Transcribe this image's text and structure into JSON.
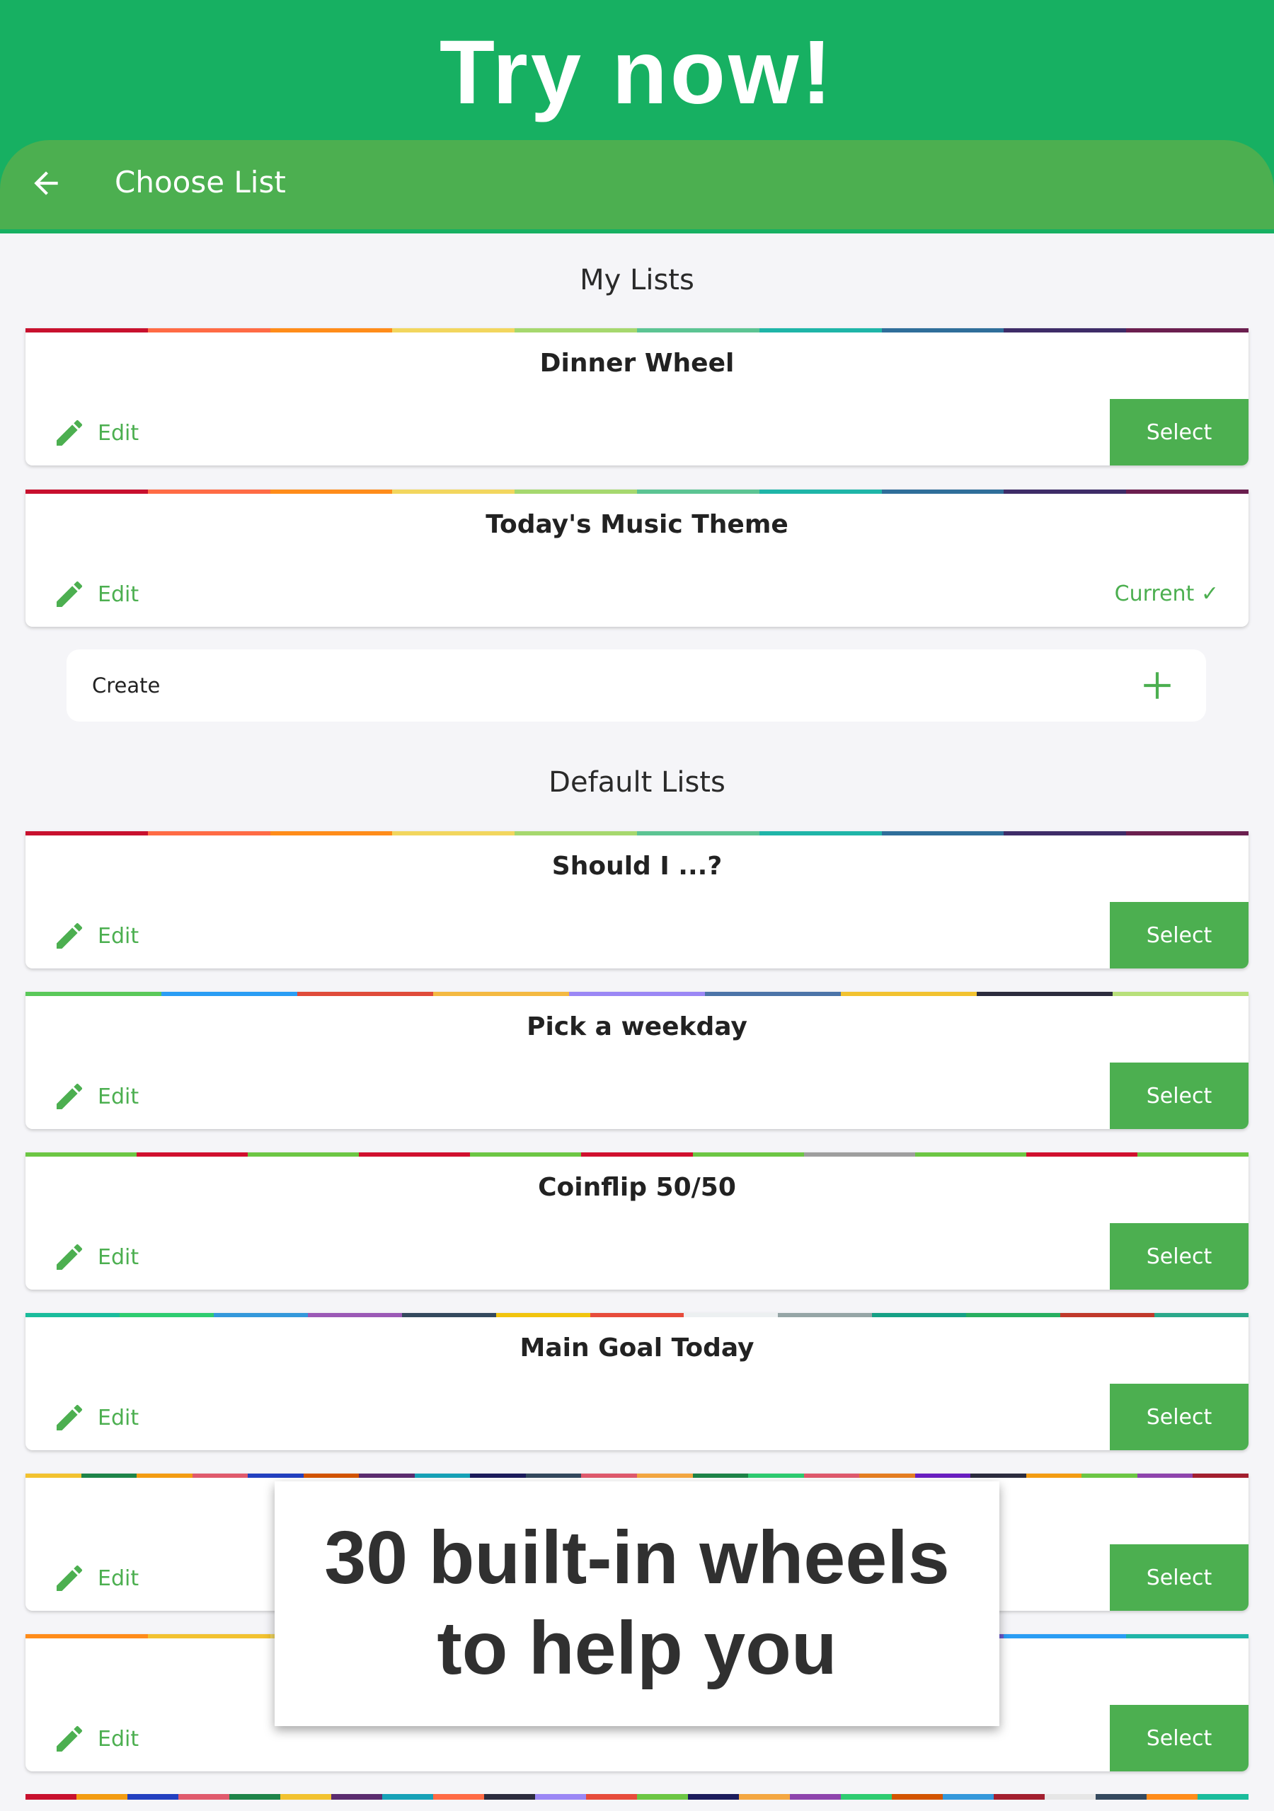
{
  "banner": {
    "title": "Try now!"
  },
  "appbar": {
    "title": "Choose List"
  },
  "my_lists": {
    "heading": "My Lists",
    "items": [
      {
        "title": "Dinner Wheel",
        "edit_label": "Edit",
        "action_label": "Select",
        "state": "select",
        "stripe": [
          "#c8102e",
          "#ff6b45",
          "#ff8c1a",
          "#f2d65e",
          "#a6d86e",
          "#5cc493",
          "#1fb5a8",
          "#2f6e9a",
          "#3e2c68",
          "#6b1f4f"
        ]
      },
      {
        "title": "Today's Music Theme",
        "edit_label": "Edit",
        "action_label": "Current ✓",
        "state": "current",
        "stripe": [
          "#c8102e",
          "#ff6b45",
          "#ff8c1a",
          "#f2d65e",
          "#a6d86e",
          "#5cc493",
          "#1fb5a8",
          "#2f6e9a",
          "#3e2c68",
          "#6b1f4f"
        ]
      }
    ],
    "create_label": "Create"
  },
  "default_lists": {
    "heading": "Default Lists",
    "items": [
      {
        "title": "Should I ...?",
        "edit_label": "Edit",
        "action_label": "Select",
        "stripe": [
          "#c8102e",
          "#ff6b45",
          "#ff8c1a",
          "#f2d65e",
          "#a6d86e",
          "#5cc493",
          "#1fb5a8",
          "#2f6e9a",
          "#3e2c68",
          "#6b1f4f"
        ]
      },
      {
        "title": "Pick a weekday",
        "edit_label": "Edit",
        "action_label": "Select",
        "stripe": [
          "#5ac85a",
          "#2a9df4",
          "#e04b3a",
          "#f4b942",
          "#9b87f5",
          "#4c74a8",
          "#f2c230",
          "#2c2c3e",
          "#b7e07a"
        ]
      },
      {
        "title": "Coinflip 50/50",
        "edit_label": "Edit",
        "action_label": "Select",
        "stripe": [
          "#6cc644",
          "#d0102e",
          "#6cc644",
          "#d0102e",
          "#6cc644",
          "#d0102e",
          "#6cc644",
          "#9e9e9e",
          "#6cc644",
          "#d0102e",
          "#6cc644"
        ]
      },
      {
        "title": "Main Goal Today",
        "edit_label": "Edit",
        "action_label": "Select",
        "stripe": [
          "#1abc9c",
          "#2ecc71",
          "#3498db",
          "#9b59b6",
          "#34495e",
          "#f1c40f",
          "#e74c3c",
          "#ecf0f1",
          "#95a5a6",
          "#16a085",
          "#27ae60",
          "#c0392b",
          "#2ba88a"
        ]
      },
      {
        "title": "",
        "edit_label": "Edit",
        "action_label": "Select",
        "stripe": [
          "#f2c230",
          "#1e8449",
          "#f39c12",
          "#e05a6d",
          "#2340c0",
          "#d35400",
          "#5b2c6f",
          "#17a2b8",
          "#1c1c5c",
          "#34495e",
          "#e05a6d",
          "#f4a742",
          "#1e8449",
          "#2ecc71",
          "#e05a6d",
          "#e67e22",
          "#6a1fc2",
          "#2c2c3e",
          "#f39c12",
          "#6cc644",
          "#8e44ad",
          "#a31f2f"
        ]
      },
      {
        "title": "",
        "edit_label": "Edit",
        "action_label": "Select",
        "stripe": [
          "#ff8c1a",
          "#f2c230",
          "#f2d65e",
          "#e6e6e6",
          "#cfcfcf",
          "#b0b0b0",
          "#9b87f5",
          "#6a5acd",
          "#2a9df4",
          "#1fb5a8"
        ]
      }
    ]
  },
  "overlay": {
    "line1": "30 built-in wheels",
    "line2": "to help you"
  },
  "bottom_stripe": [
    "#c8102e",
    "#f39c12",
    "#2340c0",
    "#e05a6d",
    "#1e8449",
    "#f2c230",
    "#5b2c6f",
    "#17a2b8",
    "#ff6b45",
    "#2c2c3e",
    "#9b87f5",
    "#e74c3c",
    "#6cc644",
    "#1c1c5c",
    "#f4a742",
    "#8e44ad",
    "#2ecc71",
    "#d35400",
    "#3498db",
    "#a31f2f",
    "#e6e6e6",
    "#34495e",
    "#ff8c1a",
    "#1abc9c"
  ]
}
